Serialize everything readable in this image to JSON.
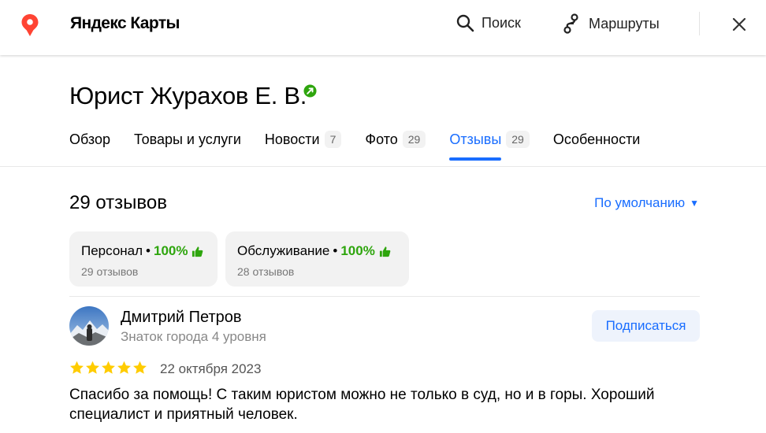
{
  "app": {
    "brand": "Яндекс Карты"
  },
  "topbar": {
    "search_label": "Поиск",
    "routes_label": "Маршруты"
  },
  "org": {
    "title": "Юрист Журахов Е. В."
  },
  "tabs": [
    {
      "label": "Обзор"
    },
    {
      "label": "Товары и услуги"
    },
    {
      "label": "Новости",
      "badge": "7"
    },
    {
      "label": "Фото",
      "badge": "29"
    },
    {
      "label": "Отзывы",
      "badge": "29",
      "active": true
    },
    {
      "label": "Особенности"
    }
  ],
  "reviews": {
    "count_label": "29 отзывов",
    "sort_label": "По умолчанию",
    "aspects": [
      {
        "name": "Персонал",
        "dot": "•",
        "percent": "100%",
        "count": "29 отзывов"
      },
      {
        "name": "Обслуживание",
        "dot": "•",
        "percent": "100%",
        "count": "28 отзывов"
      }
    ],
    "items": [
      {
        "author": "Дмитрий Петров",
        "level": "Знаток города 4 уровня",
        "subscribe_label": "Подписаться",
        "rating": 5,
        "date": "22 октября 2023",
        "text": "Спасибо за помощь! С таким юристом можно не только в суд, но и в горы. Хороший специалист и приятный человек."
      }
    ]
  },
  "icons": {
    "pin": "map-pin-icon",
    "search": "search-icon",
    "routes": "routes-icon",
    "close": "close-icon",
    "verified": "verified-icon",
    "thumb": "thumbs-up-icon",
    "star": "star-icon",
    "caret": "caret-down-icon"
  },
  "colors": {
    "accent": "#196dff",
    "positive": "#2ea50d",
    "star": "#fc0",
    "pin": "#f43"
  }
}
